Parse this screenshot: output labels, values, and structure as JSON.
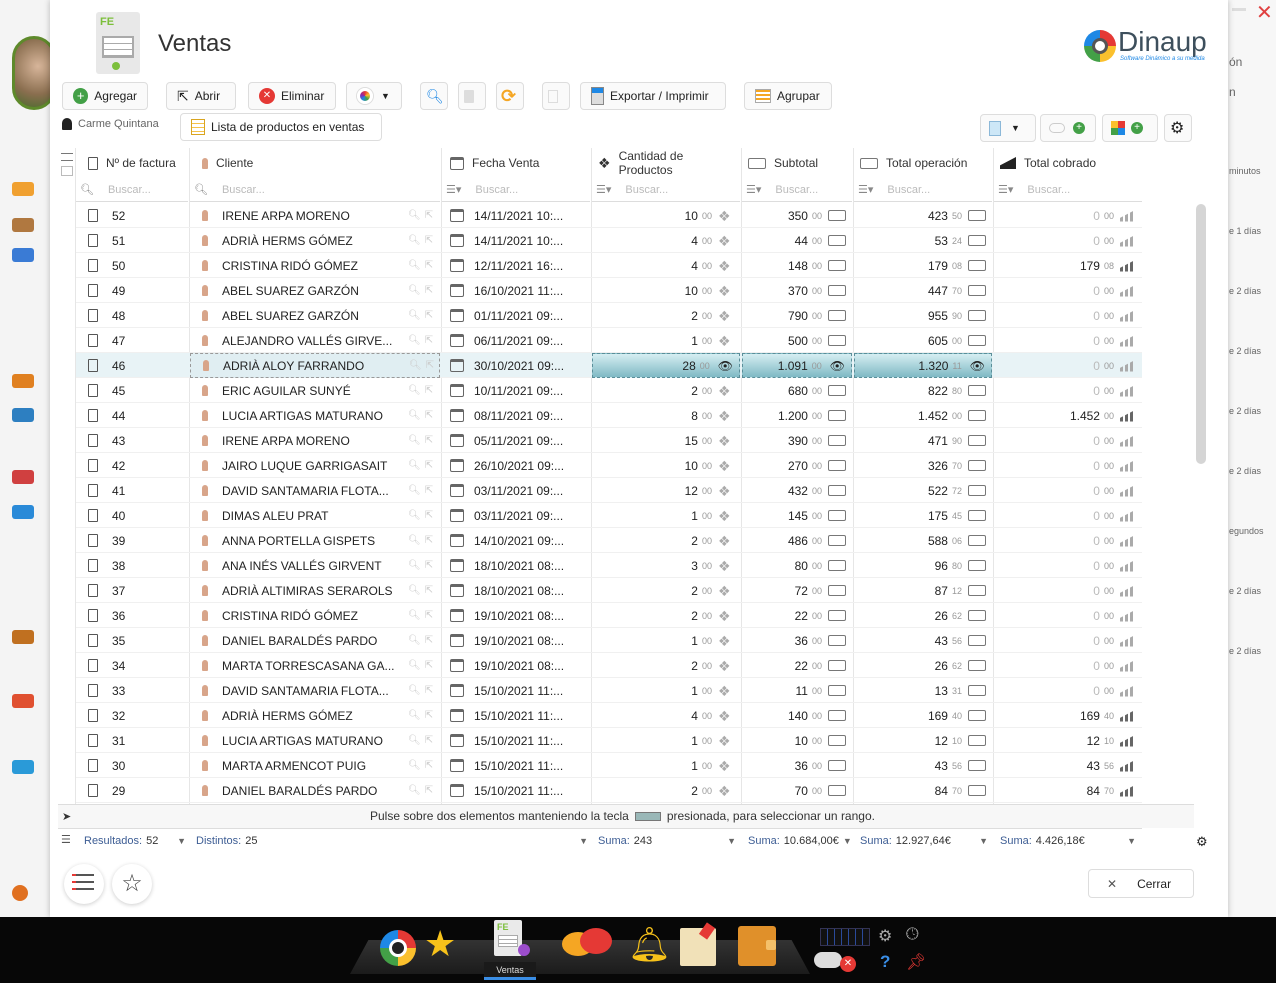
{
  "window": {
    "title": "Ventas",
    "brand": "Dinaup",
    "brand_tagline": "Software Dinámico a su medida",
    "close_label": "Cerrar"
  },
  "toolbar": {
    "add": "Agregar",
    "open": "Abrir",
    "delete": "Eliminar",
    "export": "Exportar / Imprimir",
    "group": "Agrupar"
  },
  "subbar": {
    "user": "Carme Quintana",
    "list_tab": "Lista de productos en ventas"
  },
  "columns": [
    {
      "label": "Nº de factura",
      "icon": "invoice-icon"
    },
    {
      "label": "Cliente",
      "icon": "person-icon"
    },
    {
      "label": "Fecha Venta",
      "icon": "calendar-icon"
    },
    {
      "label": "Cantidad de Productos",
      "icon": "cubes-icon"
    },
    {
      "label": "Subtotal",
      "icon": "money-icon"
    },
    {
      "label": "Total operación",
      "icon": "money-icon"
    },
    {
      "label": "Total cobrado",
      "icon": "chart-bars-icon"
    }
  ],
  "filter_placeholder": "Buscar...",
  "rows": [
    {
      "num": "52",
      "client": "IRENE ARPA MORENO",
      "date": "14/11/2021 10:...",
      "qty": "10",
      "qd": "00",
      "sub": "350",
      "sd": "00",
      "tot": "423",
      "td": "50",
      "cob": "0",
      "cd": "00",
      "selected": false,
      "cob_zero": true
    },
    {
      "num": "51",
      "client": "ADRIÀ HERMS GÓMEZ",
      "date": "14/11/2021 10:...",
      "qty": "4",
      "qd": "00",
      "sub": "44",
      "sd": "00",
      "tot": "53",
      "td": "24",
      "cob": "0",
      "cd": "00",
      "selected": false,
      "cob_zero": true
    },
    {
      "num": "50",
      "client": "CRISTINA RIDÓ GÓMEZ",
      "date": "12/11/2021 16:...",
      "qty": "4",
      "qd": "00",
      "sub": "148",
      "sd": "00",
      "tot": "179",
      "td": "08",
      "cob": "179",
      "cd": "08",
      "selected": false,
      "cob_zero": false
    },
    {
      "num": "49",
      "client": "ABEL SUAREZ GARZÓN",
      "date": "16/10/2021 11:...",
      "qty": "10",
      "qd": "00",
      "sub": "370",
      "sd": "00",
      "tot": "447",
      "td": "70",
      "cob": "0",
      "cd": "00",
      "selected": false,
      "cob_zero": true
    },
    {
      "num": "48",
      "client": "ABEL SUAREZ GARZÓN",
      "date": "01/11/2021 09:...",
      "qty": "2",
      "qd": "00",
      "sub": "790",
      "sd": "00",
      "tot": "955",
      "td": "90",
      "cob": "0",
      "cd": "00",
      "selected": false,
      "cob_zero": true
    },
    {
      "num": "47",
      "client": "ALEJANDRO VALLÉS GIRVE...",
      "date": "06/11/2021 09:...",
      "qty": "1",
      "qd": "00",
      "sub": "500",
      "sd": "00",
      "tot": "605",
      "td": "00",
      "cob": "0",
      "cd": "00",
      "selected": false,
      "cob_zero": true
    },
    {
      "num": "46",
      "client": "ADRIÀ ALOY FARRANDO",
      "date": "30/10/2021 09:...",
      "qty": "28",
      "qd": "00",
      "sub": "1.091",
      "sd": "00",
      "tot": "1.320",
      "td": "11",
      "cob": "0",
      "cd": "00",
      "selected": true,
      "cob_zero": true
    },
    {
      "num": "45",
      "client": "ERIC AGUILAR SUNYÉ",
      "date": "10/11/2021 09:...",
      "qty": "2",
      "qd": "00",
      "sub": "680",
      "sd": "00",
      "tot": "822",
      "td": "80",
      "cob": "0",
      "cd": "00",
      "selected": false,
      "cob_zero": true
    },
    {
      "num": "44",
      "client": "LUCIA ARTIGAS MATURANO",
      "date": "08/11/2021 09:...",
      "qty": "8",
      "qd": "00",
      "sub": "1.200",
      "sd": "00",
      "tot": "1.452",
      "td": "00",
      "cob": "1.452",
      "cd": "00",
      "selected": false,
      "cob_zero": false
    },
    {
      "num": "43",
      "client": "IRENE ARPA MORENO",
      "date": "05/11/2021 09:...",
      "qty": "15",
      "qd": "00",
      "sub": "390",
      "sd": "00",
      "tot": "471",
      "td": "90",
      "cob": "0",
      "cd": "00",
      "selected": false,
      "cob_zero": true
    },
    {
      "num": "42",
      "client": "JAIRO LUQUE GARRIGASAIT",
      "date": "26/10/2021 09:...",
      "qty": "10",
      "qd": "00",
      "sub": "270",
      "sd": "00",
      "tot": "326",
      "td": "70",
      "cob": "0",
      "cd": "00",
      "selected": false,
      "cob_zero": true
    },
    {
      "num": "41",
      "client": "DAVID SANTAMARIA FLOTA...",
      "date": "03/11/2021 09:...",
      "qty": "12",
      "qd": "00",
      "sub": "432",
      "sd": "00",
      "tot": "522",
      "td": "72",
      "cob": "0",
      "cd": "00",
      "selected": false,
      "cob_zero": true
    },
    {
      "num": "40",
      "client": "DIMAS ALEU PRAT",
      "date": "03/11/2021 09:...",
      "qty": "1",
      "qd": "00",
      "sub": "145",
      "sd": "00",
      "tot": "175",
      "td": "45",
      "cob": "0",
      "cd": "00",
      "selected": false,
      "cob_zero": true
    },
    {
      "num": "39",
      "client": "ANNA PORTELLA GISPETS",
      "date": "14/10/2021 09:...",
      "qty": "2",
      "qd": "00",
      "sub": "486",
      "sd": "00",
      "tot": "588",
      "td": "06",
      "cob": "0",
      "cd": "00",
      "selected": false,
      "cob_zero": true
    },
    {
      "num": "38",
      "client": "ANA INÉS VALLÉS GIRVENT",
      "date": "18/10/2021 08:...",
      "qty": "3",
      "qd": "00",
      "sub": "80",
      "sd": "00",
      "tot": "96",
      "td": "80",
      "cob": "0",
      "cd": "00",
      "selected": false,
      "cob_zero": true
    },
    {
      "num": "37",
      "client": "ADRIÀ ALTIMIRAS SERAROLS",
      "date": "18/10/2021 08:...",
      "qty": "2",
      "qd": "00",
      "sub": "72",
      "sd": "00",
      "tot": "87",
      "td": "12",
      "cob": "0",
      "cd": "00",
      "selected": false,
      "cob_zero": true
    },
    {
      "num": "36",
      "client": "CRISTINA RIDÓ GÓMEZ",
      "date": "19/10/2021 08:...",
      "qty": "2",
      "qd": "00",
      "sub": "22",
      "sd": "00",
      "tot": "26",
      "td": "62",
      "cob": "0",
      "cd": "00",
      "selected": false,
      "cob_zero": true
    },
    {
      "num": "35",
      "client": "DANIEL BARALDÉS PARDO",
      "date": "19/10/2021 08:...",
      "qty": "1",
      "qd": "00",
      "sub": "36",
      "sd": "00",
      "tot": "43",
      "td": "56",
      "cob": "0",
      "cd": "00",
      "selected": false,
      "cob_zero": true
    },
    {
      "num": "34",
      "client": "MARTA TORRESCASANA GA...",
      "date": "19/10/2021 08:...",
      "qty": "2",
      "qd": "00",
      "sub": "22",
      "sd": "00",
      "tot": "26",
      "td": "62",
      "cob": "0",
      "cd": "00",
      "selected": false,
      "cob_zero": true
    },
    {
      "num": "33",
      "client": "DAVID SANTAMARIA FLOTA...",
      "date": "15/10/2021 11:...",
      "qty": "1",
      "qd": "00",
      "sub": "11",
      "sd": "00",
      "tot": "13",
      "td": "31",
      "cob": "0",
      "cd": "00",
      "selected": false,
      "cob_zero": true
    },
    {
      "num": "32",
      "client": "ADRIÀ HERMS GÓMEZ",
      "date": "15/10/2021 11:...",
      "qty": "4",
      "qd": "00",
      "sub": "140",
      "sd": "00",
      "tot": "169",
      "td": "40",
      "cob": "169",
      "cd": "40",
      "selected": false,
      "cob_zero": false
    },
    {
      "num": "31",
      "client": "LUCIA ARTIGAS MATURANO",
      "date": "15/10/2021 11:...",
      "qty": "1",
      "qd": "00",
      "sub": "10",
      "sd": "00",
      "tot": "12",
      "td": "10",
      "cob": "12",
      "cd": "10",
      "selected": false,
      "cob_zero": false
    },
    {
      "num": "30",
      "client": "MARTA ARMENCOT PUIG",
      "date": "15/10/2021 11:...",
      "qty": "1",
      "qd": "00",
      "sub": "36",
      "sd": "00",
      "tot": "43",
      "td": "56",
      "cob": "43",
      "cd": "56",
      "selected": false,
      "cob_zero": false
    },
    {
      "num": "29",
      "client": "DANIEL BARALDÉS PARDO",
      "date": "15/10/2021 11:...",
      "qty": "2",
      "qd": "00",
      "sub": "70",
      "sd": "00",
      "tot": "84",
      "td": "70",
      "cob": "84",
      "cd": "70",
      "selected": false,
      "cob_zero": false
    }
  ],
  "hint": {
    "before": "Pulse sobre dos elementos manteniendo la tecla",
    "after": "presionada, para seleccionar un rango."
  },
  "footer": {
    "results_label": "Resultados:",
    "results_value": "52",
    "distinct_label": "Distintos:",
    "distinct_value": "25",
    "sum_label": "Suma:",
    "sum_qty": "243",
    "sum_sub": "10.684,00€",
    "sum_tot": "12.927,64€",
    "sum_cob": "4.426,18€"
  },
  "background_right": [
    "ón",
    "n",
    "minutos",
    "e 1 días",
    "e 2 días",
    "e 2 días",
    "e 2 días",
    "e 2 días",
    "egundos",
    "e 2 días",
    "e 2 días"
  ],
  "taskbar": {
    "active_label": "Ventas"
  }
}
